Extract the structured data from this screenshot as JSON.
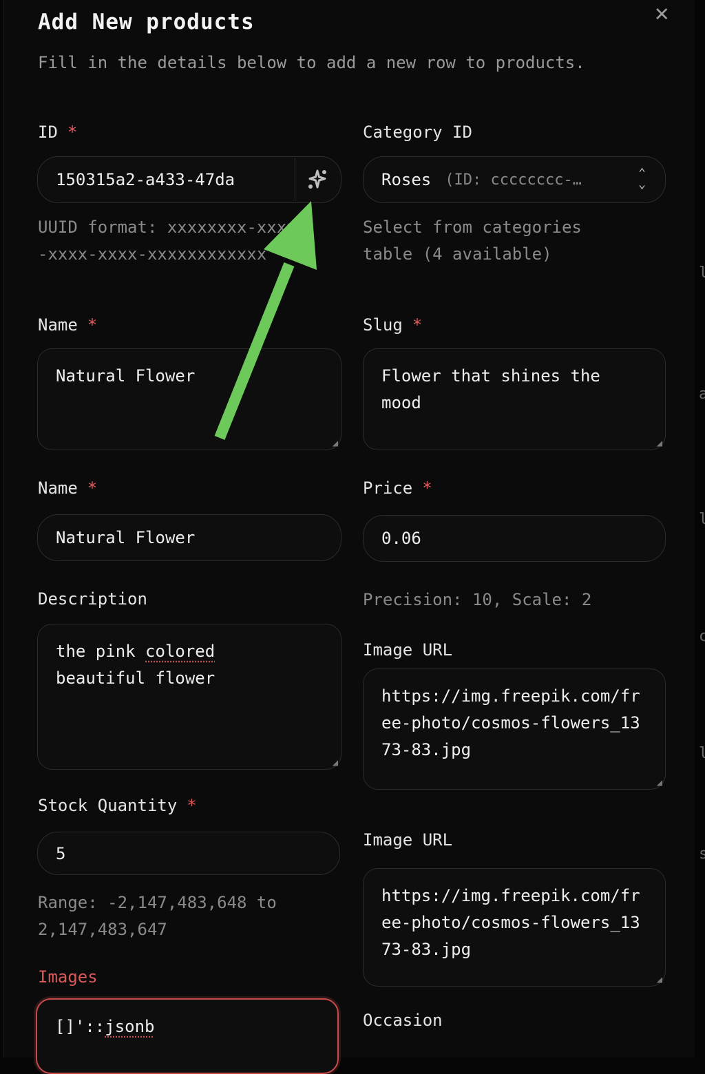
{
  "dialog": {
    "title": "Add New products",
    "subtitle": "Fill in the details below to add a new row to products."
  },
  "fields": {
    "id": {
      "label": "ID",
      "required": "*",
      "value": "150315a2-a433-47da",
      "help": "UUID format: xxxxxxxx-xxxx-xxxx-xxxx-xxxxxxxxxxxx"
    },
    "category": {
      "label": "Category ID",
      "value": "Roses",
      "value_hint": "(ID: cccccccc-…",
      "help": "Select from categories table (4 available)"
    },
    "name1": {
      "label": "Name",
      "required": "*",
      "value": "Natural Flower"
    },
    "slug": {
      "label": "Slug",
      "required": "*",
      "value": "Flower that shines the mood"
    },
    "name2": {
      "label": "Name",
      "required": "*",
      "value": "Natural Flower"
    },
    "price": {
      "label": "Price",
      "required": "*",
      "value": "0.06",
      "help": "Precision: 10, Scale: 2"
    },
    "description": {
      "label": "Description",
      "value_word1": "the pink ",
      "value_word2": "colored",
      "value_line2": "beautiful flower"
    },
    "image_url1": {
      "label": "Image URL",
      "value": "https://img.freepik.com/free-photo/cosmos-flowers_1373-83.jpg"
    },
    "stock": {
      "label": "Stock Quantity",
      "required": "*",
      "value": "5",
      "help": "Range: -2,147,483,648 to 2,147,483,647"
    },
    "image_url2": {
      "label": "Image URL",
      "value": "https://img.freepik.com/free-photo/cosmos-flowers_1373-83.jpg"
    },
    "images": {
      "label": "Images",
      "value_prefix": "[]'::",
      "value_type": "jsonb"
    },
    "occasion": {
      "label": "Occasion"
    }
  },
  "icons": {
    "close": "close-icon",
    "generate": "sparkle-icon",
    "select": "chevron-up-down-icon",
    "resize": "resize-grip-icon"
  },
  "colors": {
    "required": "#e05a5a",
    "error": "#c94b4b",
    "arrow": "#6cc95a"
  }
}
